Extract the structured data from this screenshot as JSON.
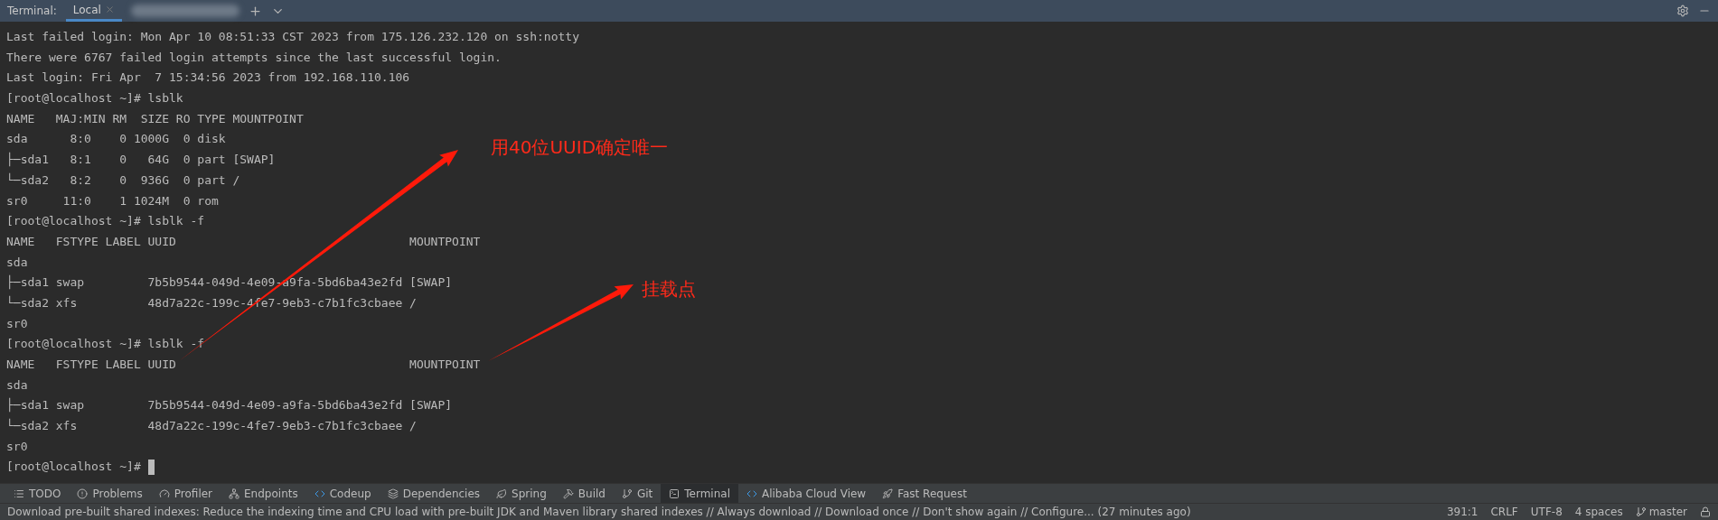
{
  "header": {
    "title": "Terminal:",
    "tabs": [
      {
        "label": "Local",
        "selected": true,
        "kind": "named"
      },
      {
        "kind": "redacted",
        "selected": false
      }
    ]
  },
  "terminal": {
    "lines": [
      "Last failed login: Mon Apr 10 08:51:33 CST 2023 from 175.126.232.120 on ssh:notty",
      "There were 6767 failed login attempts since the last successful login.",
      "Last login: Fri Apr  7 15:34:56 2023 from 192.168.110.106",
      "[root@localhost ~]# lsblk",
      "NAME   MAJ:MIN RM  SIZE RO TYPE MOUNTPOINT",
      "sda      8:0    0 1000G  0 disk",
      "├─sda1   8:1    0   64G  0 part [SWAP]",
      "└─sda2   8:2    0  936G  0 part /",
      "sr0     11:0    1 1024M  0 rom",
      "[root@localhost ~]# lsblk -f",
      "NAME   FSTYPE LABEL UUID                                 MOUNTPOINT",
      "sda",
      "├─sda1 swap         7b5b9544-049d-4e09-a9fa-5bd6ba43e2fd [SWAP]",
      "└─sda2 xfs          48d7a22c-199c-4fe7-9eb3-c7b1fc3cbaee /",
      "sr0",
      "[root@localhost ~]# lsblk -f",
      "NAME   FSTYPE LABEL UUID                                 MOUNTPOINT",
      "sda",
      "├─sda1 swap         7b5b9544-049d-4e09-a9fa-5bd6ba43e2fd [SWAP]",
      "└─sda2 xfs          48d7a22c-199c-4fe7-9eb3-c7b1fc3cbaee /",
      "sr0",
      "[root@localhost ~]# "
    ],
    "cursor": true
  },
  "annotations": [
    {
      "text": "用40位UUID确定唯一"
    },
    {
      "text": "挂载点"
    }
  ],
  "tool_windows": [
    {
      "label": "TODO",
      "selected": false
    },
    {
      "label": "Problems",
      "selected": false
    },
    {
      "label": "Profiler",
      "selected": false
    },
    {
      "label": "Endpoints",
      "selected": false
    },
    {
      "label": "Codeup",
      "selected": false
    },
    {
      "label": "Dependencies",
      "selected": false
    },
    {
      "label": "Spring",
      "selected": false
    },
    {
      "label": "Build",
      "selected": false
    },
    {
      "label": "Git",
      "selected": false
    },
    {
      "label": "Terminal",
      "selected": true
    },
    {
      "label": "Alibaba Cloud View",
      "selected": false
    },
    {
      "label": "Fast Request",
      "selected": false
    }
  ],
  "status_bar": {
    "message": "Download pre-built shared indexes: Reduce the indexing time and CPU load with pre-built JDK and Maven library shared indexes // Always download // Download once // Don't show again // Configure... (27 minutes ago)",
    "position": "391:1",
    "line_separator": "CRLF",
    "encoding": "UTF-8",
    "indent": "4 spaces",
    "branch": "master"
  }
}
